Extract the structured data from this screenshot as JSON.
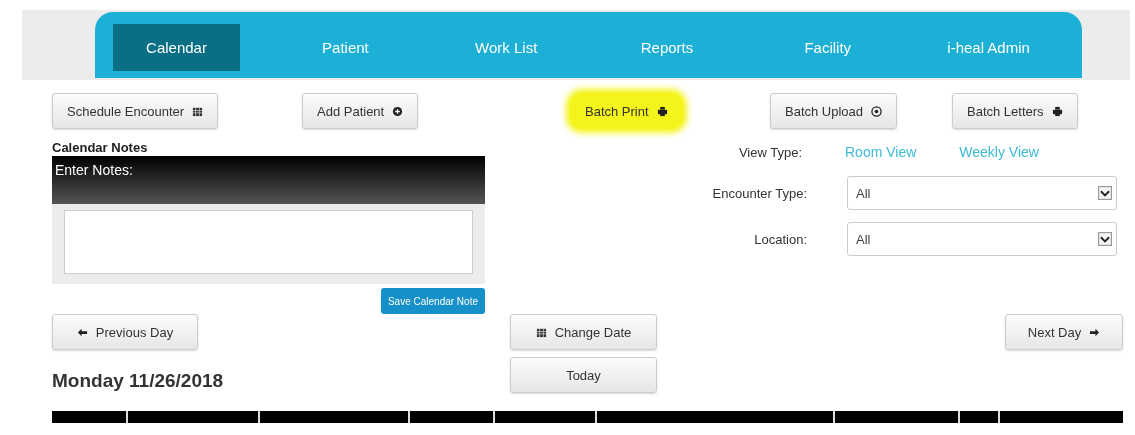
{
  "tabs": [
    {
      "label": "Calendar",
      "selected": true
    },
    {
      "label": "Patient",
      "selected": false
    },
    {
      "label": "Work List",
      "selected": false
    },
    {
      "label": "Reports",
      "selected": false
    },
    {
      "label": "Facility",
      "selected": false
    },
    {
      "label": "i-heal Admin",
      "selected": false
    }
  ],
  "actions": [
    {
      "label": "Schedule Encounter",
      "highlighted": false
    },
    {
      "label": "Add Patient",
      "highlighted": false
    },
    {
      "label": "Batch Print",
      "highlighted": true
    },
    {
      "label": "Batch Upload",
      "highlighted": false
    },
    {
      "label": "Batch Letters",
      "highlighted": false
    }
  ],
  "notes": {
    "title": "Calendar Notes",
    "header": "Enter Notes:",
    "save_button": "Save Calendar Note"
  },
  "view_type": {
    "label": "View Type:",
    "links": [
      "Room View",
      "Weekly View"
    ]
  },
  "filters": [
    {
      "label": "Encounter Type:",
      "value": "All"
    },
    {
      "label": "Location:",
      "value": "All"
    }
  ],
  "nav": {
    "previous": "Previous Day",
    "change_date": "Change Date",
    "today": "Today",
    "next": "Next Day"
  },
  "date_heading": "Monday 11/26/2018"
}
